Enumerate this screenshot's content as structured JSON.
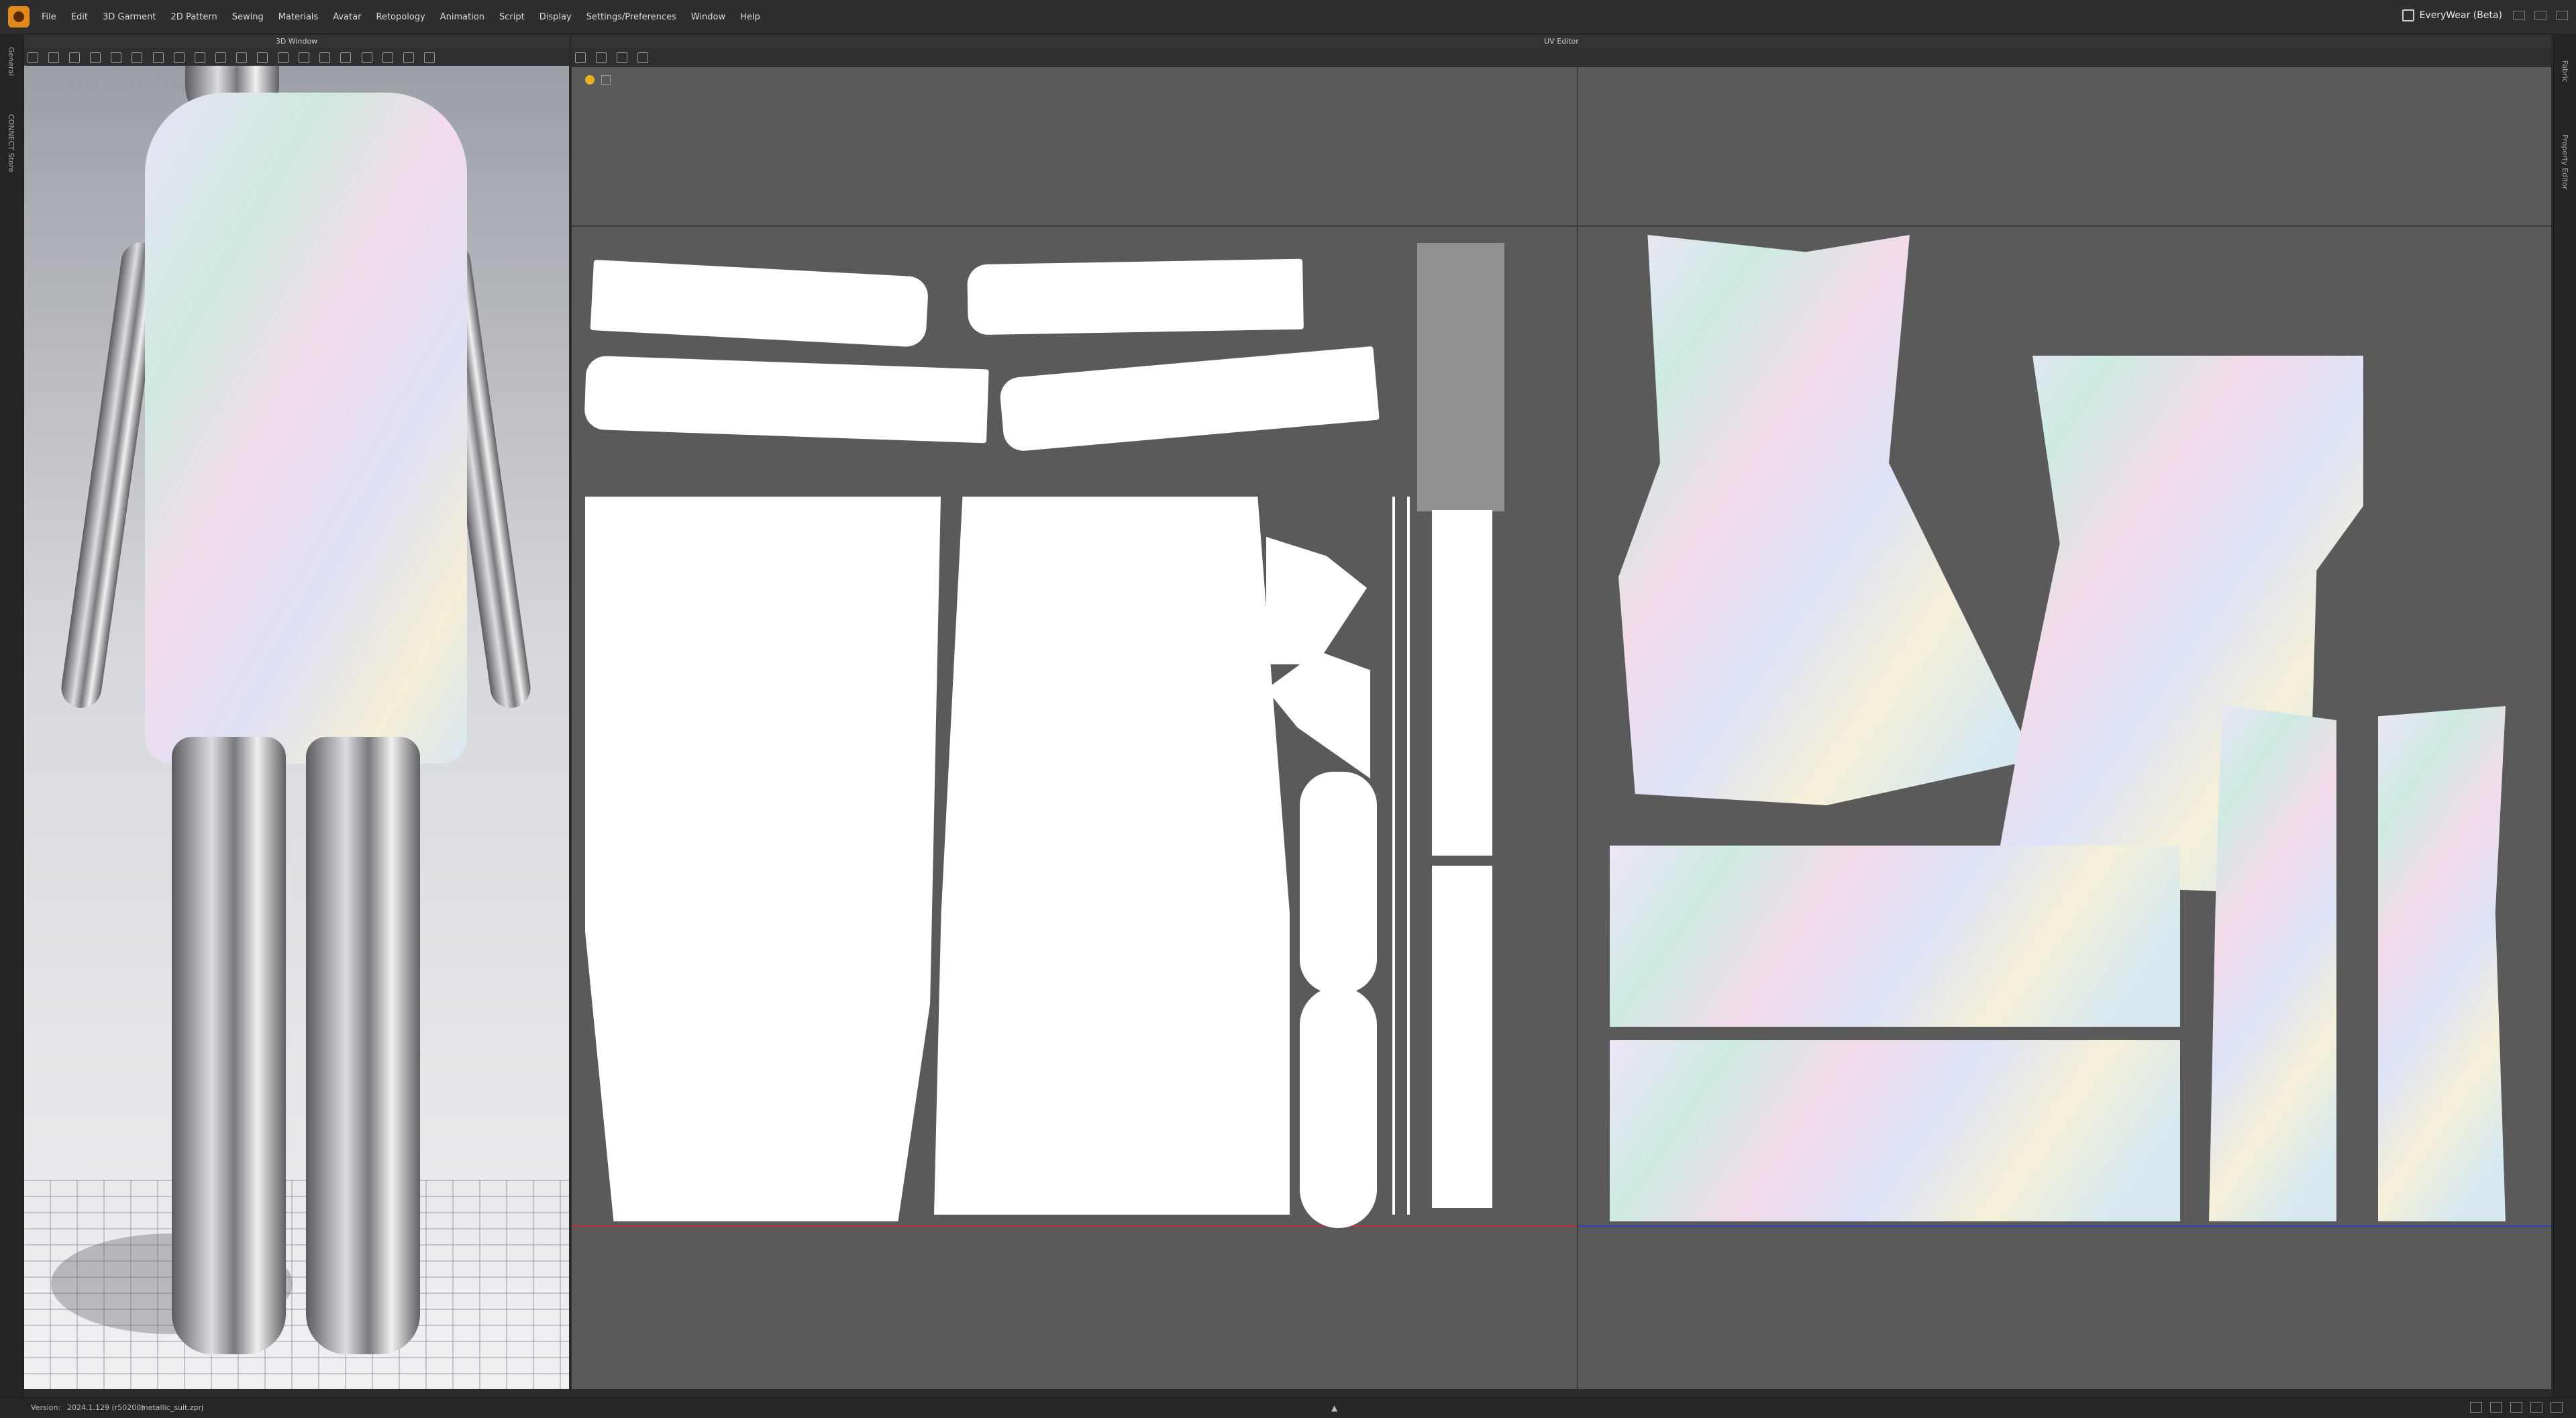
{
  "menubar": {
    "items": [
      "File",
      "Edit",
      "3D Garment",
      "2D Pattern",
      "Sewing",
      "Materials",
      "Avatar",
      "Retopology",
      "Animation",
      "Script",
      "Display",
      "Settings/Preferences",
      "Window",
      "Help"
    ],
    "brand": "EveryWear (Beta)"
  },
  "left_strip": {
    "tab1": "General",
    "tab2": "CONNECT Store"
  },
  "right_strip": {
    "tab1": "Fabric",
    "tab2": "Property Editor"
  },
  "window_3d": {
    "title": "3D Window"
  },
  "uv_editor": {
    "title": "UV Editor"
  },
  "status": {
    "label": "Version:",
    "version": "2024.1.129 (r50200)",
    "file": "metallic_suit.zprj"
  },
  "colors": {
    "accent": "#e08a1e",
    "uv_bg": "#5a5a5a",
    "piece": "#ffffff",
    "divider_red": "#c0303a",
    "divider_blue": "#3040c0"
  }
}
